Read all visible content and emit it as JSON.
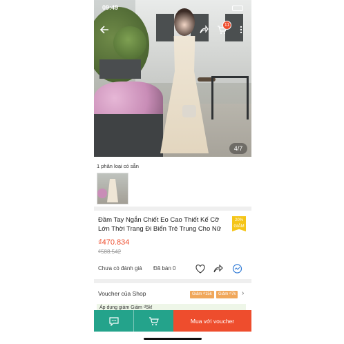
{
  "status": {
    "time": "09:49"
  },
  "nav": {
    "cart_badge": "11",
    "image_counter": "4/7"
  },
  "variants": {
    "label": "1 phân loại có sẵn"
  },
  "product": {
    "title": "Đầm Tay Ngắn Chiết Eo Cao Thiết Kế Cỡ Lớn Thời Trang Đi Biển Trẻ Trung Cho Nữ",
    "discount_badge": "20% GIẢM",
    "price": "₫470.834",
    "old_price": "₫588.542",
    "rating_text": "Chưa có đánh giá",
    "sold_text": "Đã bán 0"
  },
  "voucher": {
    "title": "Voucher của Shop",
    "tags": [
      "Giảm ₫15k",
      "Giảm ₫7k"
    ],
    "note": "Áp dụng giảm Giảm ₫5k!"
  },
  "bottom_bar": {
    "buy_label": "Mua với voucher"
  },
  "colors": {
    "accent": "#ee4d2d",
    "teal": "#24a38b",
    "badge": "#f5c518"
  }
}
